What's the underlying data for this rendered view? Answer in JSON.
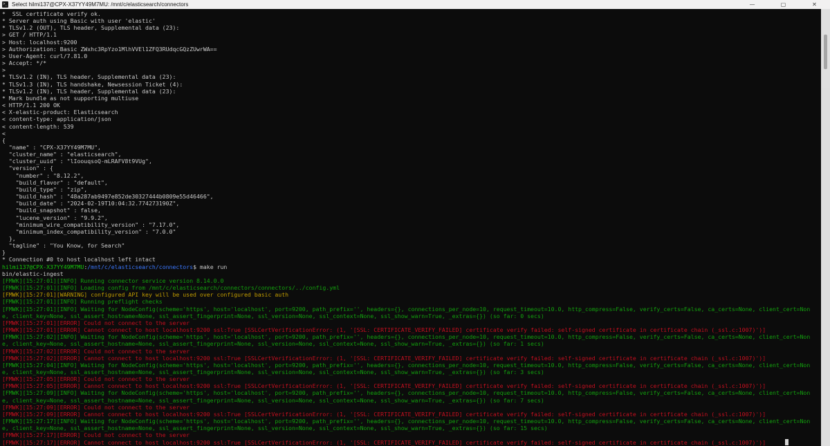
{
  "window": {
    "title": "Select hilmi137@CPX-X37YY49M7MU: /mnt/c/elasticsearch/connectors",
    "app_icon": "C:\\",
    "controls": {
      "minimize": "—",
      "maximize": "▢",
      "close": "✕"
    }
  },
  "terminal": {
    "background": "#0c0c0c",
    "cursor_visible": true,
    "palette": {
      "d": "#cccccc",
      "g": "#13a10e",
      "bg": "#16c60c",
      "bl": "#3b78ff",
      "y": "#c19c00",
      "r": "#c50f1f"
    },
    "lines": [
      [
        {
          "c": "d",
          "t": "*  SSL certificate verify ok."
        }
      ],
      [
        {
          "c": "d",
          "t": "* Server auth using Basic with user 'elastic'"
        }
      ],
      [
        {
          "c": "d",
          "t": "* TLSv1.2 (OUT), TLS header, Supplemental data (23):"
        }
      ],
      [
        {
          "c": "d",
          "t": "> GET / HTTP/1.1"
        }
      ],
      [
        {
          "c": "d",
          "t": "> Host: localhost:9200"
        }
      ],
      [
        {
          "c": "d",
          "t": "> Authorization: Basic ZWxhc3RpYzo1MlhVVEl1ZFQ3RUdqcGQzZUwrWA=="
        }
      ],
      [
        {
          "c": "d",
          "t": "> User-Agent: curl/7.81.0"
        }
      ],
      [
        {
          "c": "d",
          "t": "> Accept: */*"
        }
      ],
      [
        {
          "c": "d",
          "t": ">"
        }
      ],
      [
        {
          "c": "d",
          "t": "* TLSv1.2 (IN), TLS header, Supplemental data (23):"
        }
      ],
      [
        {
          "c": "d",
          "t": "* TLSv1.3 (IN), TLS handshake, Newsession Ticket (4):"
        }
      ],
      [
        {
          "c": "d",
          "t": "* TLSv1.2 (IN), TLS header, Supplemental data (23):"
        }
      ],
      [
        {
          "c": "d",
          "t": "* Mark bundle as not supporting multiuse"
        }
      ],
      [
        {
          "c": "d",
          "t": "< HTTP/1.1 200 OK"
        }
      ],
      [
        {
          "c": "d",
          "t": "< X-elastic-product: Elasticsearch"
        }
      ],
      [
        {
          "c": "d",
          "t": "< content-type: application/json"
        }
      ],
      [
        {
          "c": "d",
          "t": "< content-length: 539"
        }
      ],
      [
        {
          "c": "d",
          "t": "<"
        }
      ],
      [
        {
          "c": "d",
          "t": "{"
        }
      ],
      [
        {
          "c": "d",
          "t": "  \"name\" : \"CPX-X37YY49M7MU\","
        }
      ],
      [
        {
          "c": "d",
          "t": "  \"cluster_name\" : \"elasticsearch\","
        }
      ],
      [
        {
          "c": "d",
          "t": "  \"cluster_uuid\" : \"lIoouqsoQ-mLRAFV8t9VUg\","
        }
      ],
      [
        {
          "c": "d",
          "t": "  \"version\" : {"
        }
      ],
      [
        {
          "c": "d",
          "t": "    \"number\" : \"8.12.2\","
        }
      ],
      [
        {
          "c": "d",
          "t": "    \"build_flavor\" : \"default\","
        }
      ],
      [
        {
          "c": "d",
          "t": "    \"build_type\" : \"zip\","
        }
      ],
      [
        {
          "c": "d",
          "t": "    \"build_hash\" : \"48a287ab9497e852de30327444b0809e55d46466\","
        }
      ],
      [
        {
          "c": "d",
          "t": "    \"build_date\" : \"2024-02-19T10:04:32.774273190Z\","
        }
      ],
      [
        {
          "c": "d",
          "t": "    \"build_snapshot\" : false,"
        }
      ],
      [
        {
          "c": "d",
          "t": "    \"lucene_version\" : \"9.9.2\","
        }
      ],
      [
        {
          "c": "d",
          "t": "    \"minimum_wire_compatibility_version\" : \"7.17.0\","
        }
      ],
      [
        {
          "c": "d",
          "t": "    \"minimum_index_compatibility_version\" : \"7.0.0\""
        }
      ],
      [
        {
          "c": "d",
          "t": "  },"
        }
      ],
      [
        {
          "c": "d",
          "t": "  \"tagline\" : \"You Know, for Search\""
        }
      ],
      [
        {
          "c": "d",
          "t": "}"
        }
      ],
      [
        {
          "c": "d",
          "t": "* Connection #0 to host localhost left intact"
        }
      ],
      [
        {
          "c": "bg",
          "t": "hilmi137@CPX-X37YY49M7MU"
        },
        {
          "c": "d",
          "t": ":"
        },
        {
          "c": "bl",
          "t": "/mnt/c/elasticsearch/connectors"
        },
        {
          "c": "d",
          "t": "$ make run"
        }
      ],
      [
        {
          "c": "d",
          "t": "bin/elastic-ingest"
        }
      ],
      [
        {
          "c": "g",
          "t": "[FMWK][15:27:01][INFO] Running connector service version 8.14.0.0"
        }
      ],
      [
        {
          "c": "g",
          "t": "[FMWK][15:27:01][INFO] Loading config from /mnt/c/elasticsearch/connectors/connectors/../config.yml"
        }
      ],
      [
        {
          "c": "y",
          "t": "[FMWK][15:27:01][WARNING] configured API key will be used over configured basic auth"
        }
      ],
      [
        {
          "c": "g",
          "t": "[FMWK][15:27:01][INFO] Running preflight checks"
        }
      ],
      [
        {
          "c": "g",
          "t": "[FMWK][15:27:01][INFO] Waiting for NodeConfig(scheme='https', host='localhost', port=9200, path_prefix='', headers={}, connections_per_node=10, request_timeout=10.0, http_compress=False, verify_certs=False, ca_certs=None, client_cert=Non"
        }
      ],
      [
        {
          "c": "g",
          "t": "e, client_key=None, ssl_assert_hostname=None, ssl_assert_fingerprint=None, ssl_version=None, ssl_context=None, ssl_show_warn=True, _extras={}) (so far: 0 secs)"
        }
      ],
      [
        {
          "c": "r",
          "t": "[FMWK][15:27:01][ERROR] Could not connect to the server"
        }
      ],
      [
        {
          "c": "r",
          "t": "[FMWK][15:27:01][ERROR] Cannot connect to host localhost:9200 ssl:True [SSLCertVerificationError: (1, '[SSL: CERTIFICATE_VERIFY_FAILED] certificate verify failed: self-signed certificate in certificate chain (_ssl.c:1007)')]"
        }
      ],
      [
        {
          "c": "g",
          "t": "[FMWK][15:27:02][INFO] Waiting for NodeConfig(scheme='https', host='localhost', port=9200, path_prefix='', headers={}, connections_per_node=10, request_timeout=10.0, http_compress=False, verify_certs=False, ca_certs=None, client_cert=Non"
        }
      ],
      [
        {
          "c": "g",
          "t": "e, client_key=None, ssl_assert_hostname=None, ssl_assert_fingerprint=None, ssl_version=None, ssl_context=None, ssl_show_warn=True, _extras={}) (so far: 1 secs)"
        }
      ],
      [
        {
          "c": "r",
          "t": "[FMWK][15:27:02][ERROR] Could not connect to the server"
        }
      ],
      [
        {
          "c": "r",
          "t": "[FMWK][15:27:02][ERROR] Cannot connect to host localhost:9200 ssl:True [SSLCertVerificationError: (1, '[SSL: CERTIFICATE_VERIFY_FAILED] certificate verify failed: self-signed certificate in certificate chain (_ssl.c:1007)')]"
        }
      ],
      [
        {
          "c": "g",
          "t": "[FMWK][15:27:04][INFO] Waiting for NodeConfig(scheme='https', host='localhost', port=9200, path_prefix='', headers={}, connections_per_node=10, request_timeout=10.0, http_compress=False, verify_certs=False, ca_certs=None, client_cert=Non"
        }
      ],
      [
        {
          "c": "g",
          "t": "e, client_key=None, ssl_assert_hostname=None, ssl_assert_fingerprint=None, ssl_version=None, ssl_context=None, ssl_show_warn=True, _extras={}) (so far: 3 secs)"
        }
      ],
      [
        {
          "c": "r",
          "t": "[FMWK][15:27:05][ERROR] Could not connect to the server"
        }
      ],
      [
        {
          "c": "r",
          "t": "[FMWK][15:27:05][ERROR] Cannot connect to host localhost:9200 ssl:True [SSLCertVerificationError: (1, '[SSL: CERTIFICATE_VERIFY_FAILED] certificate verify failed: self-signed certificate in certificate chain (_ssl.c:1007)')]"
        }
      ],
      [
        {
          "c": "g",
          "t": "[FMWK][15:27:09][INFO] Waiting for NodeConfig(scheme='https', host='localhost', port=9200, path_prefix='', headers={}, connections_per_node=10, request_timeout=10.0, http_compress=False, verify_certs=False, ca_certs=None, client_cert=Non"
        }
      ],
      [
        {
          "c": "g",
          "t": "e, client_key=None, ssl_assert_hostname=None, ssl_assert_fingerprint=None, ssl_version=None, ssl_context=None, ssl_show_warn=True, _extras={}) (so far: 7 secs)"
        }
      ],
      [
        {
          "c": "r",
          "t": "[FMWK][15:27:09][ERROR] Could not connect to the server"
        }
      ],
      [
        {
          "c": "r",
          "t": "[FMWK][15:27:09][ERROR] Cannot connect to host localhost:9200 ssl:True [SSLCertVerificationError: (1, '[SSL: CERTIFICATE_VERIFY_FAILED] certificate verify failed: self-signed certificate in certificate chain (_ssl.c:1007)')]"
        }
      ],
      [
        {
          "c": "g",
          "t": "[FMWK][15:27:17][INFO] Waiting for NodeConfig(scheme='https', host='localhost', port=9200, path_prefix='', headers={}, connections_per_node=10, request_timeout=10.0, http_compress=False, verify_certs=False, ca_certs=None, client_cert=Non"
        }
      ],
      [
        {
          "c": "g",
          "t": "e, client_key=None, ssl_assert_hostname=None, ssl_assert_fingerprint=None, ssl_version=None, ssl_context=None, ssl_show_warn=True, _extras={}) (so far: 15 secs)"
        }
      ],
      [
        {
          "c": "r",
          "t": "[FMWK][15:27:17][ERROR] Could not connect to the server"
        }
      ],
      [
        {
          "c": "r",
          "t": "[FMWK][15:27:17][ERROR] Cannot connect to host localhost:9200 ssl:True [SSLCertVerificationError: (1, '[SSL: CERTIFICATE_VERIFY_FAILED] certificate verify failed: self-signed certificate in certificate chain (_ssl.c:1007)')]"
        }
      ]
    ]
  }
}
